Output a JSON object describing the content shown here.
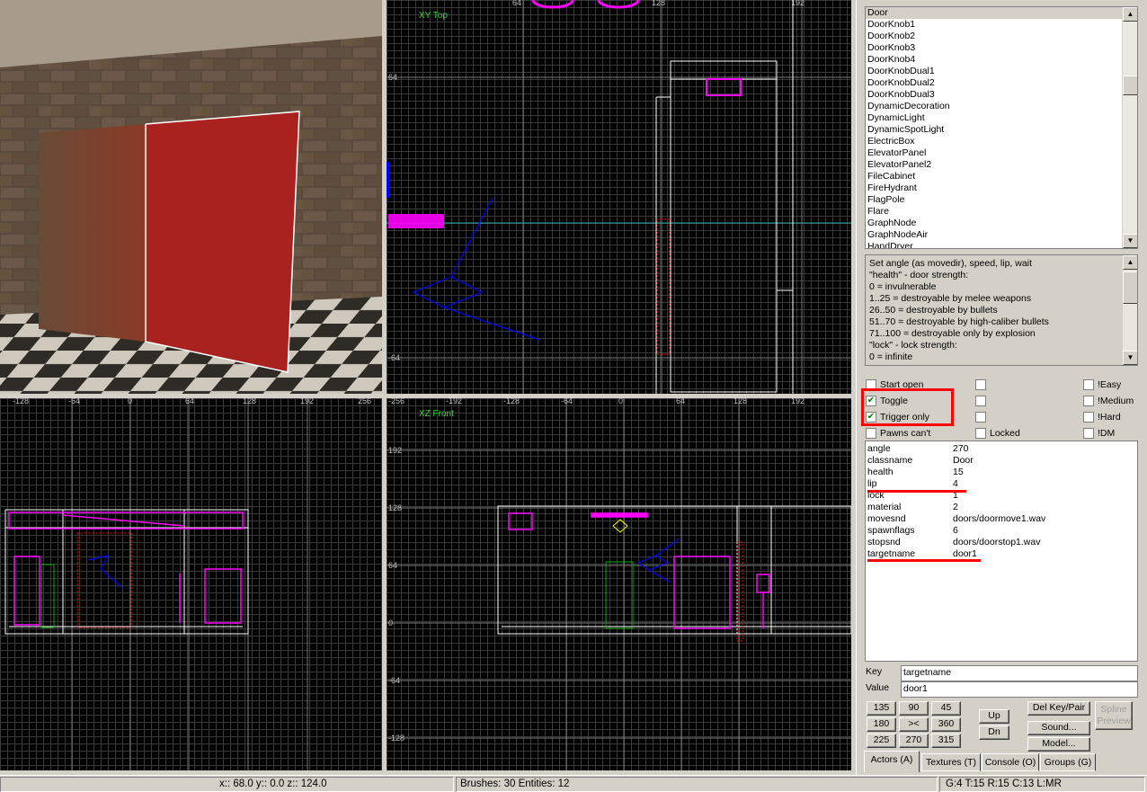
{
  "viewports": {
    "top": {
      "label": "XY Top",
      "ticks_x": [
        "64",
        "128",
        "192"
      ],
      "ticks_y": [
        "64",
        "-64"
      ]
    },
    "side": {
      "ticks_x": [
        "-128",
        "-64",
        "0",
        "64",
        "128",
        "192",
        "256"
      ]
    },
    "front": {
      "label": "XZ Front",
      "ticks_x": [
        "-256",
        "-192",
        "-128",
        "-64",
        "0",
        "64",
        "128",
        "192"
      ],
      "ticks_y": [
        "192",
        "128",
        "64",
        "0",
        "-64",
        "-128"
      ]
    }
  },
  "actor_list": {
    "items": [
      "Door",
      "DoorKnob1",
      "DoorKnob2",
      "DoorKnob3",
      "DoorKnob4",
      "DoorKnobDual1",
      "DoorKnobDual2",
      "DoorKnobDual3",
      "DynamicDecoration",
      "DynamicLight",
      "DynamicSpotLight",
      "ElectricBox",
      "ElevatorPanel",
      "ElevatorPanel2",
      "FileCabinet",
      "FireHydrant",
      "FlagPole",
      "Flare",
      "GraphNode",
      "GraphNodeAir",
      "HandDryer"
    ],
    "selected": "Door"
  },
  "description": {
    "lines": [
      "Set angle (as movedir), speed, lip, wait",
      "\"health\" - door strength:",
      "0 = invulnerable",
      "1..25 = destroyable by melee weapons",
      "26..50 = destroyable by bullets",
      "51..70 = destroyable by high-caliber bullets",
      "71..100 = destroyable only by explosion",
      "\"lock\" - lock strength:",
      "0 = infinite"
    ]
  },
  "flags": {
    "start_open": {
      "label": "Start open",
      "checked": false
    },
    "toggle": {
      "label": "Toggle",
      "checked": true
    },
    "trigger_only": {
      "label": "Trigger only",
      "checked": true
    },
    "pawns_cant": {
      "label": "Pawns can't",
      "checked": false
    },
    "locked": {
      "label": "Locked",
      "checked": false
    },
    "easy": {
      "label": "!Easy",
      "checked": false
    },
    "medium": {
      "label": "!Medium",
      "checked": false
    },
    "hard": {
      "label": "!Hard",
      "checked": false
    },
    "dm": {
      "label": "!DM",
      "checked": false
    }
  },
  "properties": [
    {
      "key": "angle",
      "value": "270"
    },
    {
      "key": "classname",
      "value": "Door"
    },
    {
      "key": "health",
      "value": "15"
    },
    {
      "key": "lip",
      "value": "4"
    },
    {
      "key": "lock",
      "value": "1"
    },
    {
      "key": "material",
      "value": "2"
    },
    {
      "key": "movesnd",
      "value": "doors/doormove1.wav"
    },
    {
      "key": "spawnflags",
      "value": "6"
    },
    {
      "key": "stopsnd",
      "value": "doors/doorstop1.wav"
    },
    {
      "key": "targetname",
      "value": "door1"
    }
  ],
  "editor": {
    "key_label": "Key",
    "value_label": "Value",
    "key": "targetname",
    "value": "door1"
  },
  "angle_buttons": [
    "135",
    "90",
    "45",
    "180",
    "><",
    "360",
    "225",
    "270",
    "315"
  ],
  "buttons": {
    "up": "Up",
    "dn": "Dn",
    "del_key": "Del Key/Pair",
    "sound": "Sound...",
    "model": "Model...",
    "spline_preview": "Spline Preview"
  },
  "tabs": [
    "Actors (A)",
    "Textures (T)",
    "Console (O)",
    "Groups (G)"
  ],
  "status": {
    "coords": "x:: 68.0  y:: 0.0  z:: 124.0",
    "counts": "Brushes: 30 Entities: 12",
    "grid": "G:4 T:15 R:15 C:13 L:MR"
  },
  "colors": {
    "entity": "#ff00ff",
    "brush": "#ffffff",
    "selection": "#ff0000",
    "vector": "#0000ff",
    "highlight": "#ff0000"
  }
}
